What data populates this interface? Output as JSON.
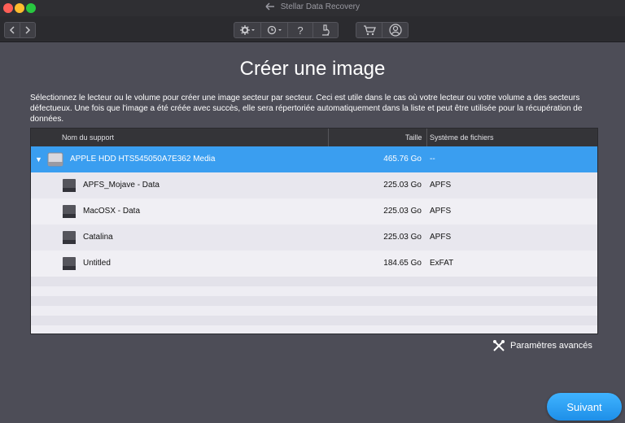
{
  "window": {
    "title": "Stellar Data Recovery"
  },
  "toolbar": {
    "back_icon": "chevron-left-icon",
    "forward_icon": "chevron-right-icon",
    "settings_icon": "gear-icon",
    "history_icon": "clock-history-icon",
    "help_label": "?",
    "scan_icon": "microscope-icon",
    "cart_icon": "cart-icon",
    "account_icon": "user-icon"
  },
  "page": {
    "title": "Créer une image",
    "description": "Sélectionnez le lecteur ou le volume pour créer une image secteur par secteur. Ceci est utile dans le cas où votre lecteur ou votre volume a des secteurs défectueux. Une fois que l'image a été créée avec succès, elle sera répertoriée automatiquement dans la liste et peut être utilisée pour la récupération de données."
  },
  "table": {
    "headers": {
      "name": "Nom du support",
      "size": "Taille",
      "fs": "Système de fichiers"
    },
    "rows": [
      {
        "name": "APPLE HDD HTS545050A7E362 Media",
        "size": "465.76 Go",
        "fs": "--",
        "expand": "▼"
      },
      {
        "name": "APFS_Mojave - Data",
        "size": "225.03 Go",
        "fs": "APFS"
      },
      {
        "name": "MacOSX - Data",
        "size": "225.03 Go",
        "fs": "APFS"
      },
      {
        "name": "Catalina",
        "size": "225.03 Go",
        "fs": "APFS"
      },
      {
        "name": "Untitled",
        "size": "184.65 Go",
        "fs": "ExFAT"
      }
    ]
  },
  "advanced": {
    "label": "Paramètres avancés",
    "icon": "tools-icon"
  },
  "next_button": {
    "label": "Suivant"
  },
  "colors": {
    "accent": "#3a9ef0",
    "background": "#4d4d57",
    "toolbar": "#2b2b2f"
  }
}
